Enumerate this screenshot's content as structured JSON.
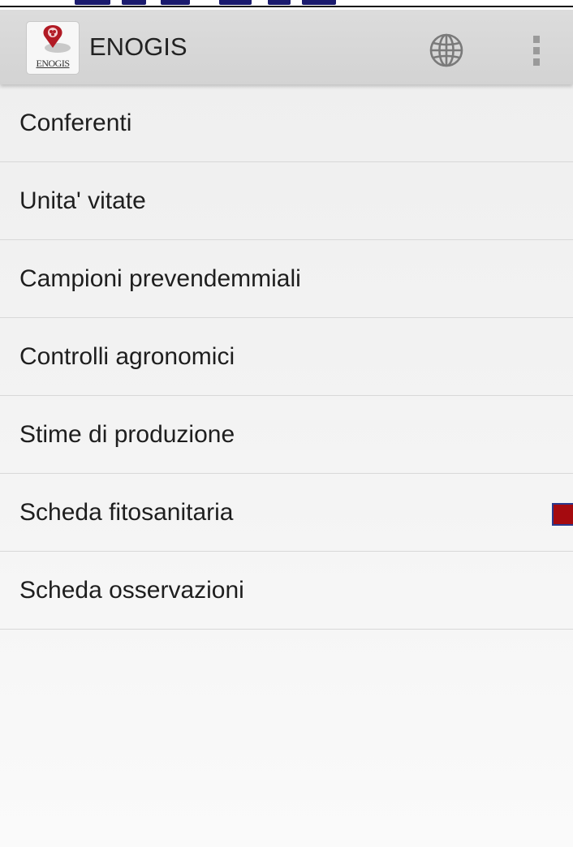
{
  "app": {
    "title": "ENOGIS",
    "logo_text": "ENOGIS"
  },
  "toolbar": {
    "globe_icon": "globe-icon",
    "overflow_icon": "more-vert-icon"
  },
  "menu": {
    "items": [
      {
        "label": "Conferenti"
      },
      {
        "label": "Unita' vitate"
      },
      {
        "label": "Campioni prevendemmiali"
      },
      {
        "label": "Controlli agronomici"
      },
      {
        "label": "Stime di produzione"
      },
      {
        "label": "Scheda fitosanitaria",
        "indicator_color": "#a50a0f"
      },
      {
        "label": "Scheda osservazioni"
      }
    ]
  },
  "colors": {
    "appbar": "#d6d6d6",
    "background": "#f2f2f2",
    "accent_red": "#a50a0f",
    "indicator_border": "#2b3a8c"
  }
}
